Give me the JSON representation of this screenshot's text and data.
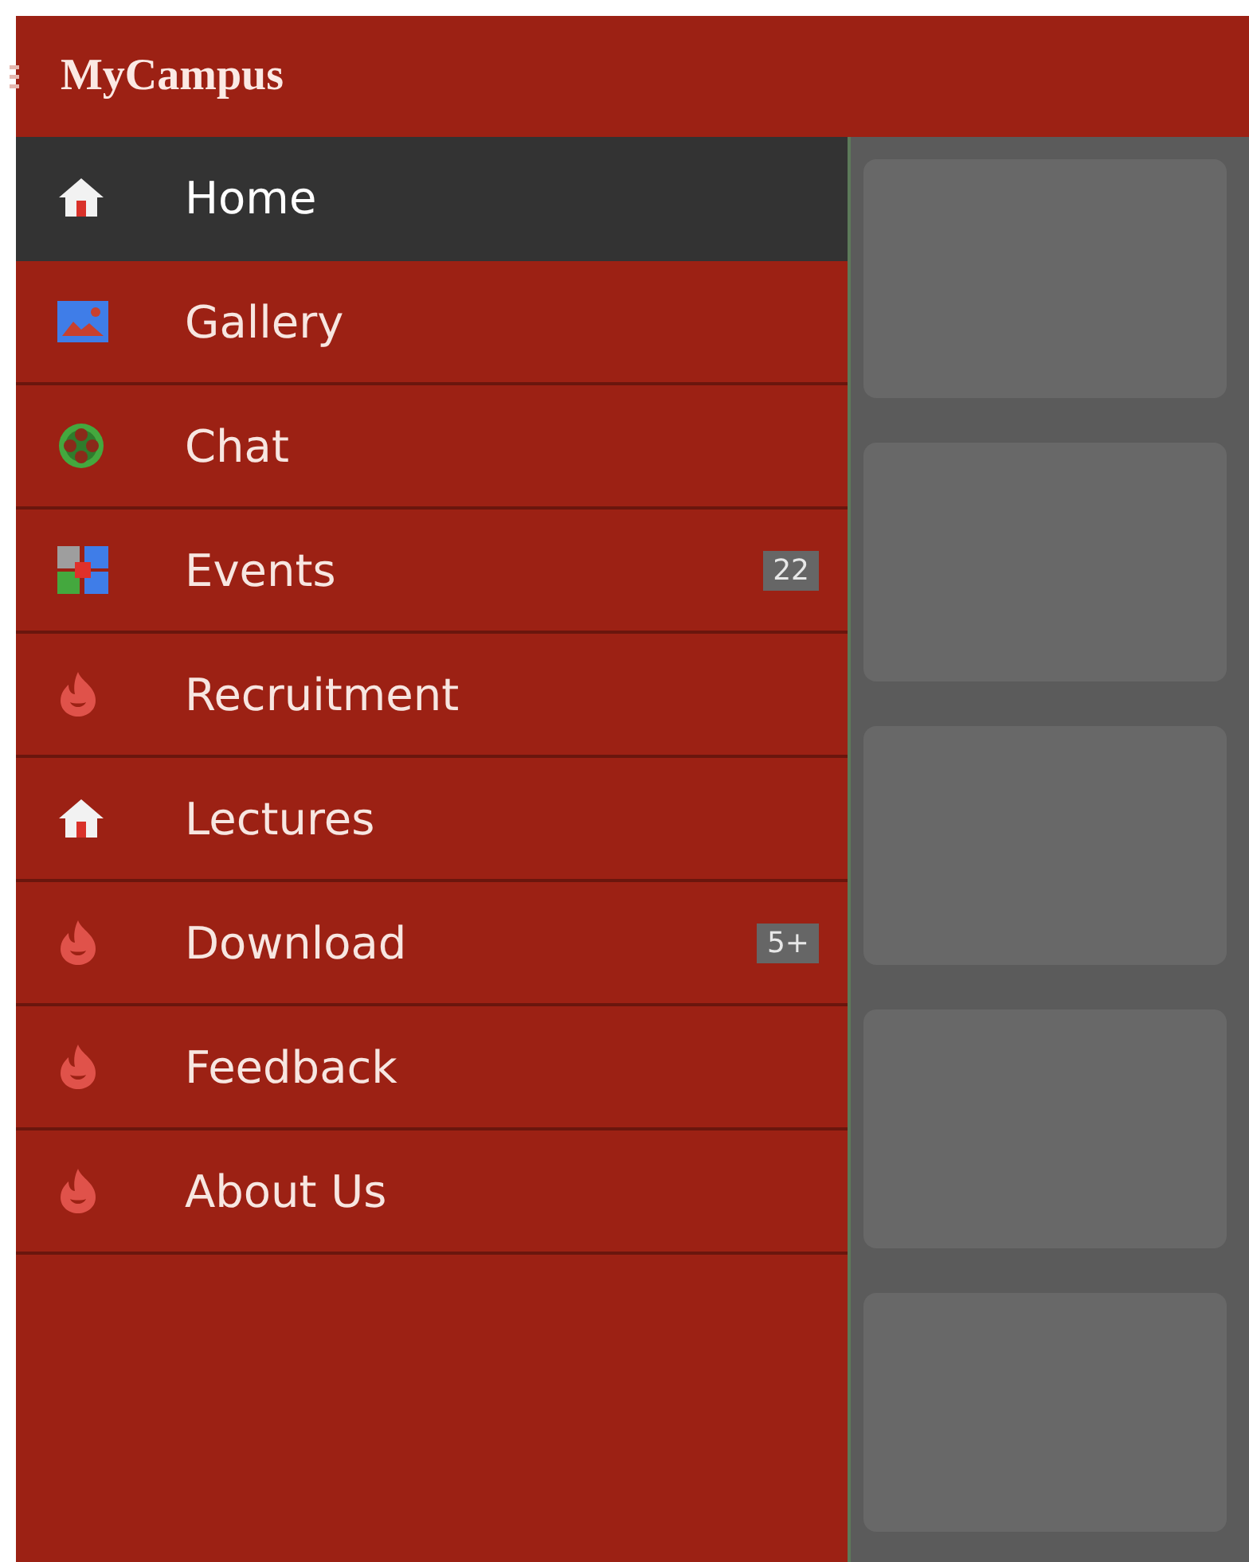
{
  "app_bar": {
    "title": "MyCampus"
  },
  "drawer": {
    "items": [
      {
        "label": "Home",
        "selected": true
      },
      {
        "label": "Gallery",
        "selected": false
      },
      {
        "label": "Chat",
        "selected": false
      },
      {
        "label": "Events",
        "selected": false,
        "badge": "22"
      },
      {
        "label": "Recruitment",
        "selected": false
      },
      {
        "label": "Lectures",
        "selected": false
      },
      {
        "label": "Download",
        "selected": false,
        "badge": "5+"
      },
      {
        "label": "Feedback",
        "selected": false
      },
      {
        "label": "About Us",
        "selected": false
      }
    ]
  }
}
